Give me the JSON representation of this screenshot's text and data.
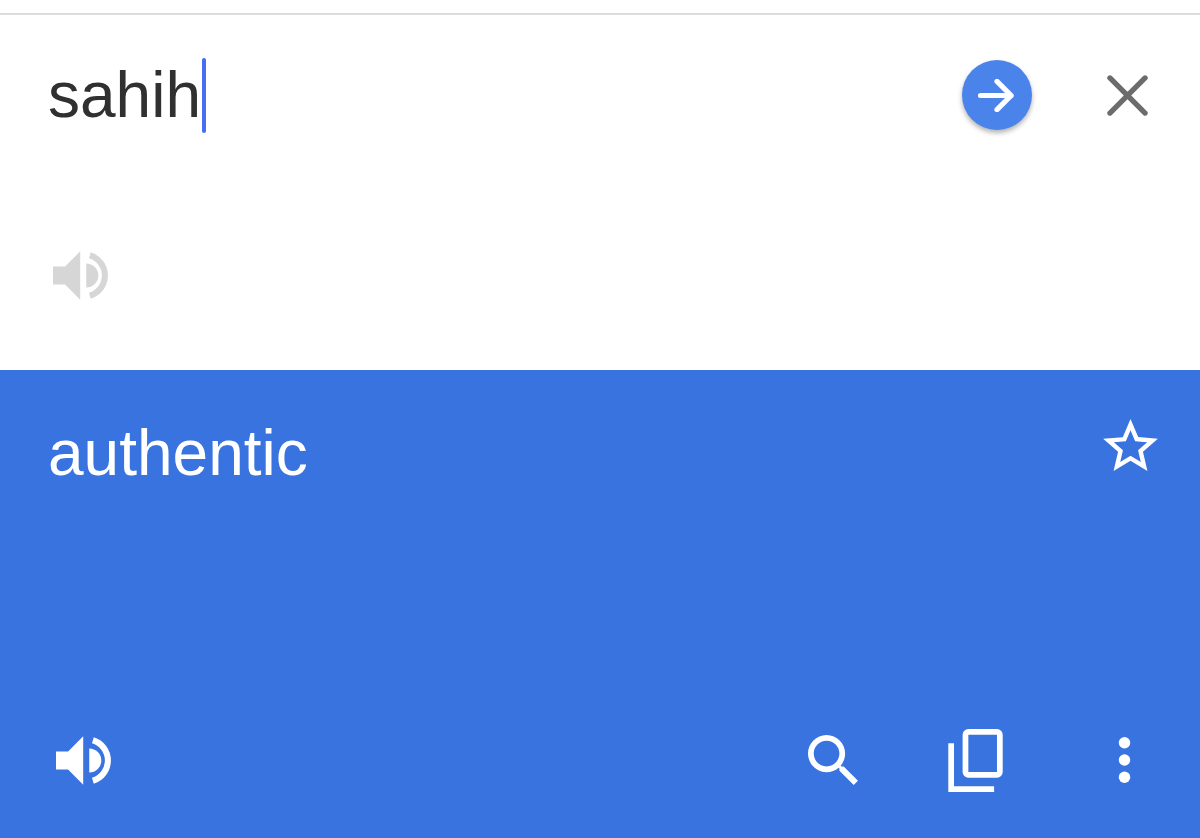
{
  "source": {
    "value": "sahih",
    "focused": true,
    "listen_disabled": true
  },
  "translation": {
    "text": "authentic",
    "starred": false
  }
}
